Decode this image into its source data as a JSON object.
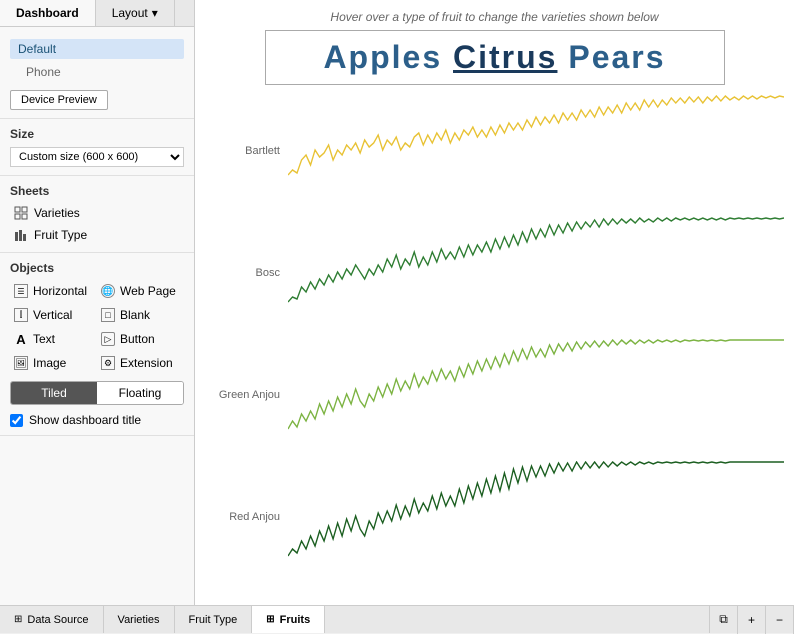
{
  "tabs": {
    "dashboard": "Dashboard",
    "layout": "Layout"
  },
  "sidebar": {
    "device_preview_btn": "Device Preview",
    "devices": [
      {
        "label": "Default",
        "selected": true
      },
      {
        "label": "Phone",
        "selected": false
      }
    ],
    "size_section": {
      "title": "Size",
      "value": "Custom size (600 x 600)"
    },
    "sheets_section": {
      "title": "Sheets",
      "items": [
        {
          "label": "Varieties",
          "icon": "grid"
        },
        {
          "label": "Fruit Type",
          "icon": "grid"
        }
      ]
    },
    "objects_section": {
      "title": "Objects",
      "items": [
        {
          "label": "Horizontal",
          "side": "left",
          "icon": "H"
        },
        {
          "label": "Web Page",
          "side": "right",
          "icon": "globe"
        },
        {
          "label": "Vertical",
          "side": "left",
          "icon": "V"
        },
        {
          "label": "Blank",
          "side": "right",
          "icon": "blank"
        },
        {
          "label": "Text",
          "side": "left",
          "icon": "A"
        },
        {
          "label": "Button",
          "side": "right",
          "icon": "btn"
        },
        {
          "label": "Image",
          "side": "left",
          "icon": "img"
        },
        {
          "label": "Extension",
          "side": "right",
          "icon": "ext"
        }
      ]
    },
    "tiled_btn": "Tiled",
    "floating_btn": "Floating",
    "show_title": "Show dashboard title"
  },
  "chart": {
    "hover_hint": "Hover over a type of fruit to change the varieties shown below",
    "title": {
      "apples": "Apples",
      "citrus": "Citrus",
      "pears": "Pears"
    },
    "rows": [
      {
        "label": "Bartlett",
        "color": "#e8c234"
      },
      {
        "label": "Bosc",
        "color": "#2e7d32"
      },
      {
        "label": "Green Anjou",
        "color": "#7cb342"
      },
      {
        "label": "Red Anjou",
        "color": "#1b5e20"
      }
    ]
  },
  "bottom_tabs": [
    {
      "label": "Data Source",
      "icon": "db",
      "active": false
    },
    {
      "label": "Varieties",
      "icon": "",
      "active": false
    },
    {
      "label": "Fruit Type",
      "icon": "",
      "active": false
    },
    {
      "label": "Fruits",
      "icon": "grid",
      "active": true
    }
  ],
  "bottom_actions": [
    "duplicate",
    "add",
    "remove"
  ]
}
